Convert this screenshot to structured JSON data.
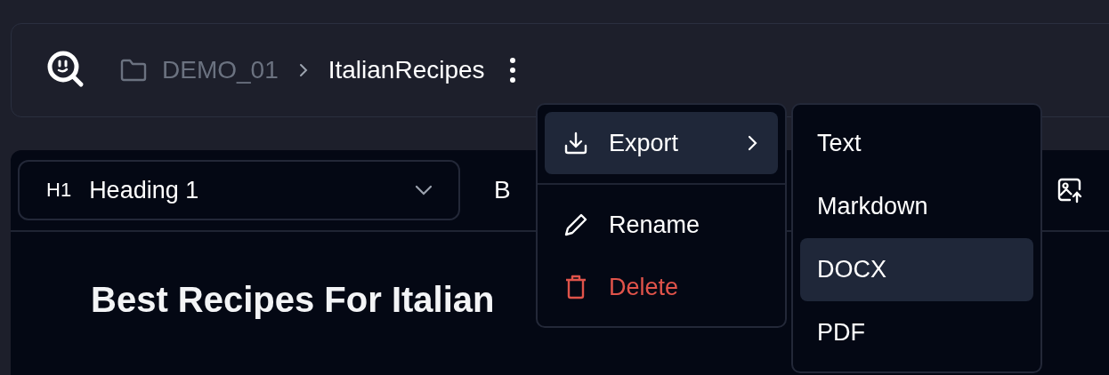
{
  "header": {
    "folder": "DEMO_01",
    "document": "ItalianRecipes"
  },
  "toolbar": {
    "block_type": "Heading 1",
    "block_badge": "H1",
    "bold_label": "B"
  },
  "document": {
    "heading": "Best Recipes For Italian"
  },
  "menu": {
    "items": [
      {
        "kind": "export",
        "label": "Export",
        "selected": true,
        "has_submenu": true
      },
      {
        "kind": "rename",
        "label": "Rename",
        "selected": false,
        "has_submenu": false
      },
      {
        "kind": "delete",
        "label": "Delete",
        "selected": false,
        "has_submenu": false
      }
    ]
  },
  "submenu": {
    "items": [
      {
        "label": "Text",
        "selected": false
      },
      {
        "label": "Markdown",
        "selected": false
      },
      {
        "label": "DOCX",
        "selected": true
      },
      {
        "label": "PDF",
        "selected": false
      }
    ]
  }
}
